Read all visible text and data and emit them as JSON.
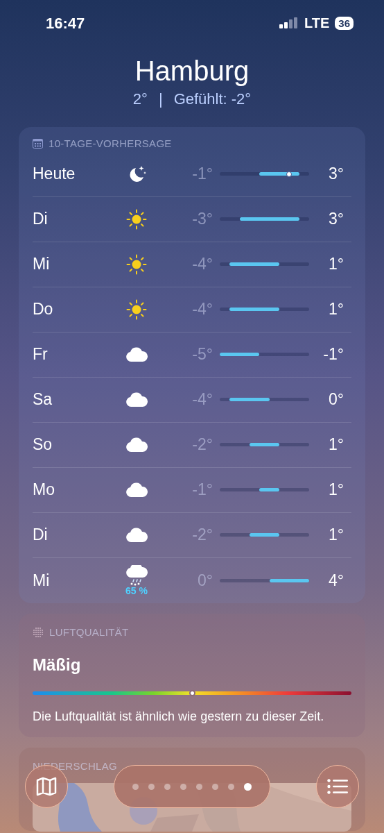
{
  "status_bar": {
    "time": "16:47",
    "network": "LTE",
    "battery": "36"
  },
  "location": {
    "city": "Hamburg",
    "current": "2°",
    "separator": "|",
    "feels_like": "Gefühlt: -2°"
  },
  "forecast": {
    "title": "10-TAGE-VORHERSAGE",
    "days": [
      {
        "day": "Heute",
        "kind": "moon",
        "low": "-1°",
        "high": "3°",
        "current_marker": true
      },
      {
        "day": "Di",
        "kind": "sun",
        "low": "-3°",
        "high": "3°",
        "current_marker": false
      },
      {
        "day": "Mi",
        "kind": "sun",
        "low": "-4°",
        "high": "1°",
        "current_marker": false
      },
      {
        "day": "Do",
        "kind": "sun",
        "low": "-4°",
        "high": "1°",
        "current_marker": false
      },
      {
        "day": "Fr",
        "kind": "cloud",
        "low": "-5°",
        "high": "-1°",
        "current_marker": false
      },
      {
        "day": "Sa",
        "kind": "cloud",
        "low": "-4°",
        "high": "0°",
        "current_marker": false
      },
      {
        "day": "So",
        "kind": "cloud",
        "low": "-2°",
        "high": "1°",
        "current_marker": false
      },
      {
        "day": "Mo",
        "kind": "cloud",
        "low": "-1°",
        "high": "1°",
        "current_marker": false
      },
      {
        "day": "Di",
        "kind": "cloud",
        "low": "-2°",
        "high": "1°",
        "current_marker": false
      },
      {
        "day": "Mi",
        "kind": "snow",
        "precipitation": "65 %",
        "low": "0°",
        "high": "4°",
        "current_marker": false
      }
    ]
  },
  "air_quality": {
    "title": "LUFTQUALITÄT",
    "rating": "Mäßig",
    "level": 0.5,
    "description": "Die Luftqualität ist ähnlich wie gestern zu dieser Zeit."
  },
  "precipitation_card": {
    "title": "NIEDERSCHLAG"
  },
  "pages": [
    {
      "selected": false
    },
    {
      "selected": false
    },
    {
      "selected": false
    },
    {
      "selected": false
    },
    {
      "selected": false
    },
    {
      "selected": false
    },
    {
      "selected": false
    },
    {
      "selected": true
    }
  ]
}
